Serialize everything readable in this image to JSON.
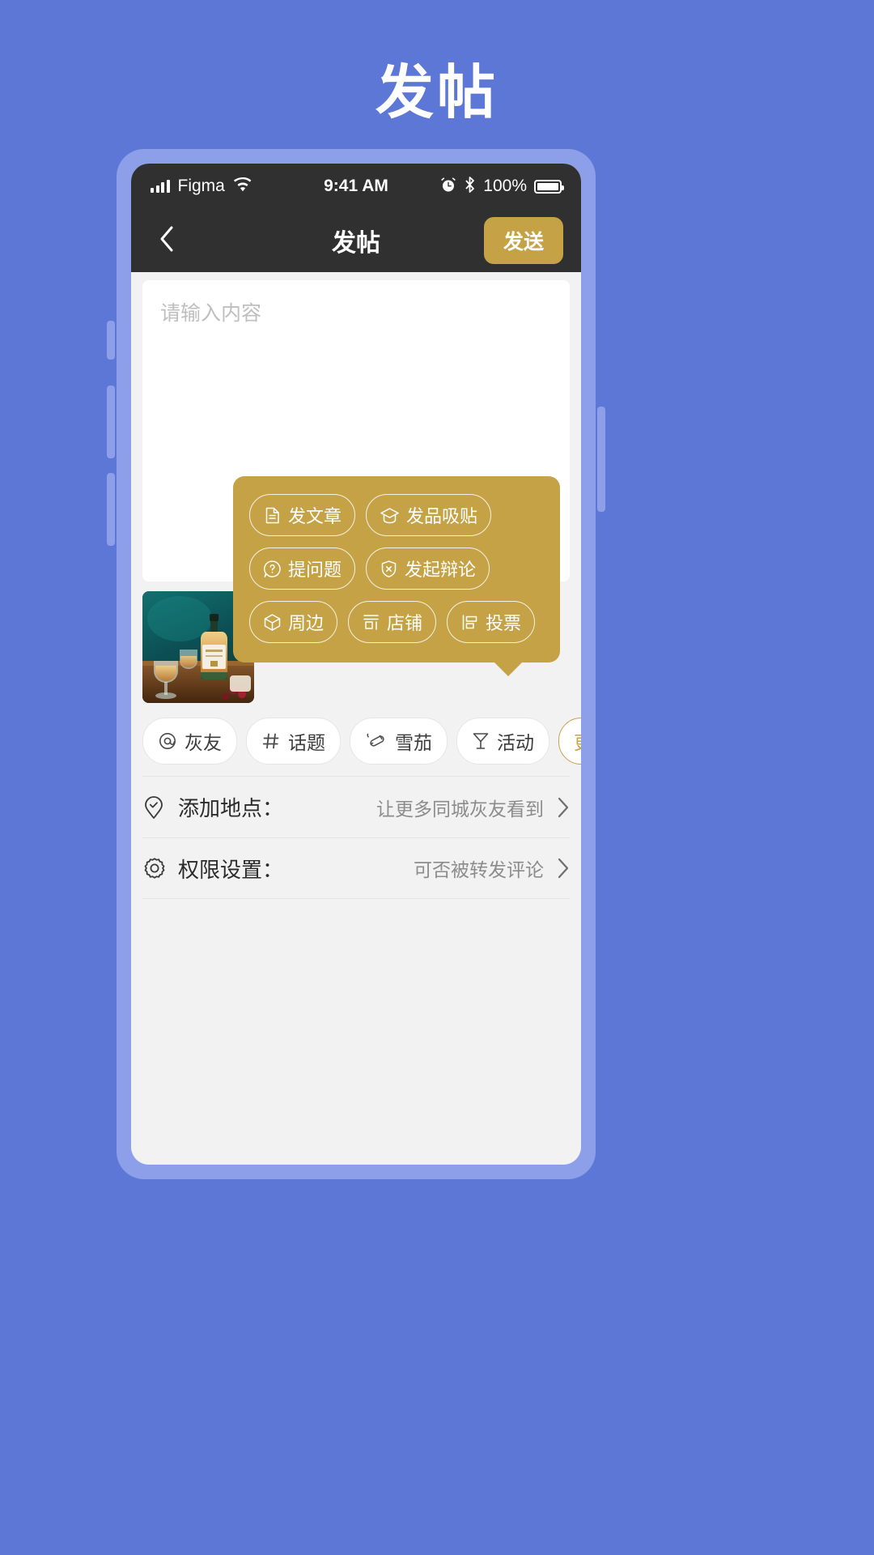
{
  "page": {
    "title": "发帖",
    "background_color": "#5c77d6"
  },
  "status_bar": {
    "carrier": "Figma",
    "time": "9:41 AM",
    "battery_percent": "100%",
    "signal_icon": "signal-bars-icon",
    "wifi_icon": "wifi-icon",
    "alarm_icon": "alarm-clock-icon",
    "bluetooth_icon": "bluetooth-icon",
    "battery_icon": "battery-full-icon"
  },
  "nav_bar": {
    "back_icon": "chevron-left-icon",
    "title": "发帖",
    "send_label": "发送",
    "send_color": "#c5a246",
    "background_color": "#303030"
  },
  "composer": {
    "placeholder": "请输入内容",
    "value": ""
  },
  "attachments": [
    {
      "name": "whisky-bottle-photo",
      "alt": "whisky bottle and glasses on wooden table"
    }
  ],
  "toolbar": {
    "chips": [
      {
        "label": "灰友",
        "icon": "at-sign-icon"
      },
      {
        "label": "话题",
        "icon": "hash-icon"
      },
      {
        "label": "雪茄",
        "icon": "cigar-icon"
      },
      {
        "label": "活动",
        "icon": "cocktail-glass-icon"
      }
    ],
    "more": {
      "label": "更多",
      "icon": "chevron-up-icon",
      "color": "#c5a246"
    }
  },
  "popover": {
    "background_color": "#c5a246",
    "options": [
      {
        "label": "发文章",
        "icon": "document-icon"
      },
      {
        "label": "发品吸贴",
        "icon": "graduation-cap-icon"
      },
      {
        "label": "提问题",
        "icon": "question-bubble-icon"
      },
      {
        "label": "发起辩论",
        "icon": "shield-x-icon"
      },
      {
        "label": "周边",
        "icon": "cube-icon"
      },
      {
        "label": "店铺",
        "icon": "store-icon"
      },
      {
        "label": "投票",
        "icon": "poll-icon"
      }
    ]
  },
  "settings": [
    {
      "icon": "location-pin-check-icon",
      "label": "添加地点：",
      "value": "让更多同城灰友看到",
      "chevron": "chevron-right-icon"
    },
    {
      "icon": "gear-icon",
      "label": "权限设置：",
      "value": "可否被转发评论",
      "chevron": "chevron-right-icon"
    }
  ]
}
